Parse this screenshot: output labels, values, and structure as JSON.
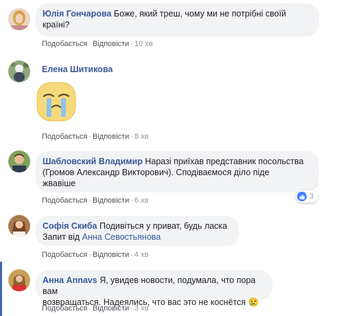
{
  "colors": {
    "link": "#385898",
    "bubble": "#f2f3f5",
    "meta": "#90949c",
    "accent": "#4267b2"
  },
  "comments": [
    {
      "author": "Юлія Гончарова",
      "text_line1": "Боже, який треш, чому ми не потрібні своїй",
      "text_line2": "країні?",
      "like": "Подобається",
      "reply": "Відповісти",
      "time": "10 хв"
    },
    {
      "author": "Елена Шитикова",
      "sticker": "crying-face-sticker",
      "like": "Подобається",
      "reply": "Відповісти",
      "time": "8 хв"
    },
    {
      "author": "Шабловский Владимир",
      "text_line1": "Наразі приїхав представник посольства",
      "text_line2": "(Громов Александр Викторович). Сподіваємося діло піде",
      "text_line3": "жвавіше",
      "like": "Подобається",
      "reply": "Відповісти",
      "time": "6 хв",
      "reaction_count": "3"
    },
    {
      "author": "Софія Скиба",
      "text_line1": "Подивіться у приват, будь ласка",
      "text_line2_prefix": "Запит від",
      "text_line2_mention": "Анна Севостьянова",
      "like": "Подобається",
      "reply": "Відповісти",
      "time": "4 хв"
    },
    {
      "author": "Анна Annavs",
      "text_line1": "Я, увидев новости, подумала, что пора вам",
      "text_line2": "возвращаться. Надеялись, что вас это не коснётся",
      "emoji": "😢",
      "like": "Подобається",
      "reply": "Відповісти",
      "time": "3 хв"
    }
  ]
}
